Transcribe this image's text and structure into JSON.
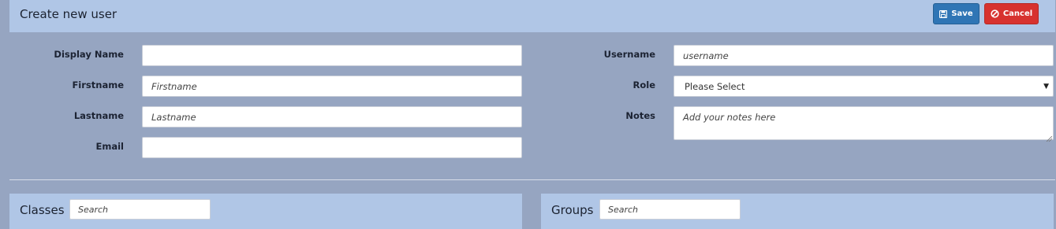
{
  "header": {
    "title": "Create new user",
    "save_label": "Save",
    "cancel_label": "Cancel"
  },
  "form": {
    "display_name": {
      "label": "Display Name",
      "value": "",
      "placeholder": ""
    },
    "firstname": {
      "label": "Firstname",
      "value": "",
      "placeholder": "Firstname"
    },
    "lastname": {
      "label": "Lastname",
      "value": "",
      "placeholder": "Lastname"
    },
    "email": {
      "label": "Email",
      "value": "",
      "placeholder": ""
    },
    "username": {
      "label": "Username",
      "value": "",
      "placeholder": "username"
    },
    "role": {
      "label": "Role",
      "selected": "Please Select"
    },
    "notes": {
      "label": "Notes",
      "value": "",
      "placeholder": "Add your notes here"
    }
  },
  "classes": {
    "title": "Classes",
    "search_placeholder": "Search"
  },
  "groups": {
    "title": "Groups",
    "search_placeholder": "Search"
  },
  "colors": {
    "background": "#96a5c1",
    "panel": "#b0c6e6",
    "save": "#2f75b5",
    "cancel": "#d7322f"
  },
  "icons": {
    "save": "floppy-disk-icon",
    "cancel": "ban-icon",
    "select": "caret-down-icon"
  }
}
